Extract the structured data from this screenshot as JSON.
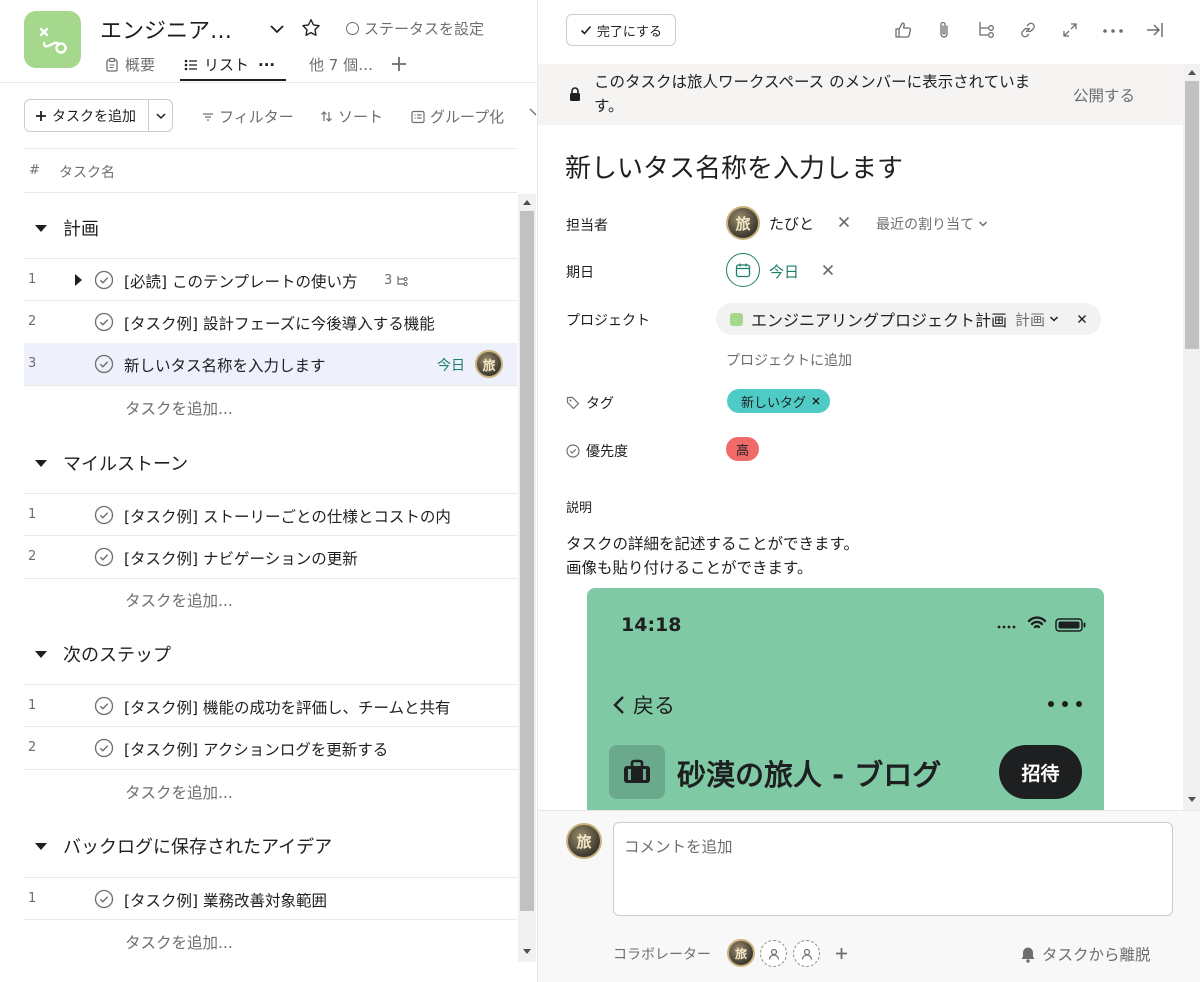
{
  "project": {
    "title": "エンジニア…",
    "status_label": "ステータスを設定",
    "accent": "#a5d88d",
    "tabs": [
      {
        "label": "概要"
      },
      {
        "label": "リスト"
      },
      {
        "label": "他 7 個…"
      }
    ],
    "tab_more": "···"
  },
  "toolbar": {
    "add_task": "タスクを追加",
    "filter": "フィルター",
    "sort": "ソート",
    "group": "グループ化"
  },
  "columns": {
    "num": "#",
    "name": "タスク名"
  },
  "sections": [
    {
      "title": "計画",
      "tasks": [
        {
          "num": "1",
          "name": "[必読] このテンプレートの使い方",
          "subtasks": "3"
        },
        {
          "num": "2",
          "name": "[タスク例] 設計フェーズに今後導入する機能"
        },
        {
          "num": "3",
          "name": "新しいタス名称を入力します",
          "due": "今日"
        }
      ],
      "add_label": "タスクを追加..."
    },
    {
      "title": "マイルストーン",
      "tasks": [
        {
          "num": "1",
          "name": "[タスク例] ストーリーごとの仕様とコストの内"
        },
        {
          "num": "2",
          "name": "[タスク例] ナビゲーションの更新"
        }
      ],
      "add_label": "タスクを追加..."
    },
    {
      "title": "次のステップ",
      "tasks": [
        {
          "num": "1",
          "name": "[タスク例] 機能の成功を評価し、チームと共有"
        },
        {
          "num": "2",
          "name": "[タスク例] アクションログを更新する"
        }
      ],
      "add_label": "タスクを追加..."
    },
    {
      "title": "バックログに保存されたアイデア",
      "tasks": [
        {
          "num": "1",
          "name": "[タスク例] 業務改善対象範囲"
        }
      ],
      "add_label": "タスクを追加..."
    }
  ],
  "detail": {
    "complete_btn": "完了にする",
    "notice": "このタスクは旅人ワークスペース のメンバーに表示されています。",
    "publish": "公開する",
    "title": "新しいタス名称を入力します",
    "fields": {
      "assignee_label": "担当者",
      "assignee_name": "たびと",
      "recent_assign": "最近の割り当て",
      "due_label": "期日",
      "due_value": "今日",
      "project_label": "プロジェクト",
      "project_name": "エンジニアリングプロジェクト計画",
      "project_section": "計画",
      "add_project": "プロジェクトに追加",
      "tag_label": "タグ",
      "tag_value": "新しいタグ",
      "priority_label": "優先度",
      "priority_value": "高"
    },
    "description_label": "説明",
    "description_lines": [
      "タスクの詳細を記述することができます。",
      "画像も貼り付けることができます。"
    ],
    "image": {
      "time": "14:18",
      "back": "戻る",
      "blog_title": "砂漠の旅人 - ブログ",
      "invite": "招待",
      "bg": "#7fcaa5"
    },
    "avatar_char": "旅",
    "comment_placeholder": "コメントを追加",
    "collaborators_label": "コラボレーター",
    "leave_task": "タスクから離脱"
  },
  "colors": {
    "due_green": "#1e7d67",
    "tag_teal": "#4ecbc4",
    "priority_red": "#f06a6a",
    "selected_row": "#eef0fb"
  }
}
